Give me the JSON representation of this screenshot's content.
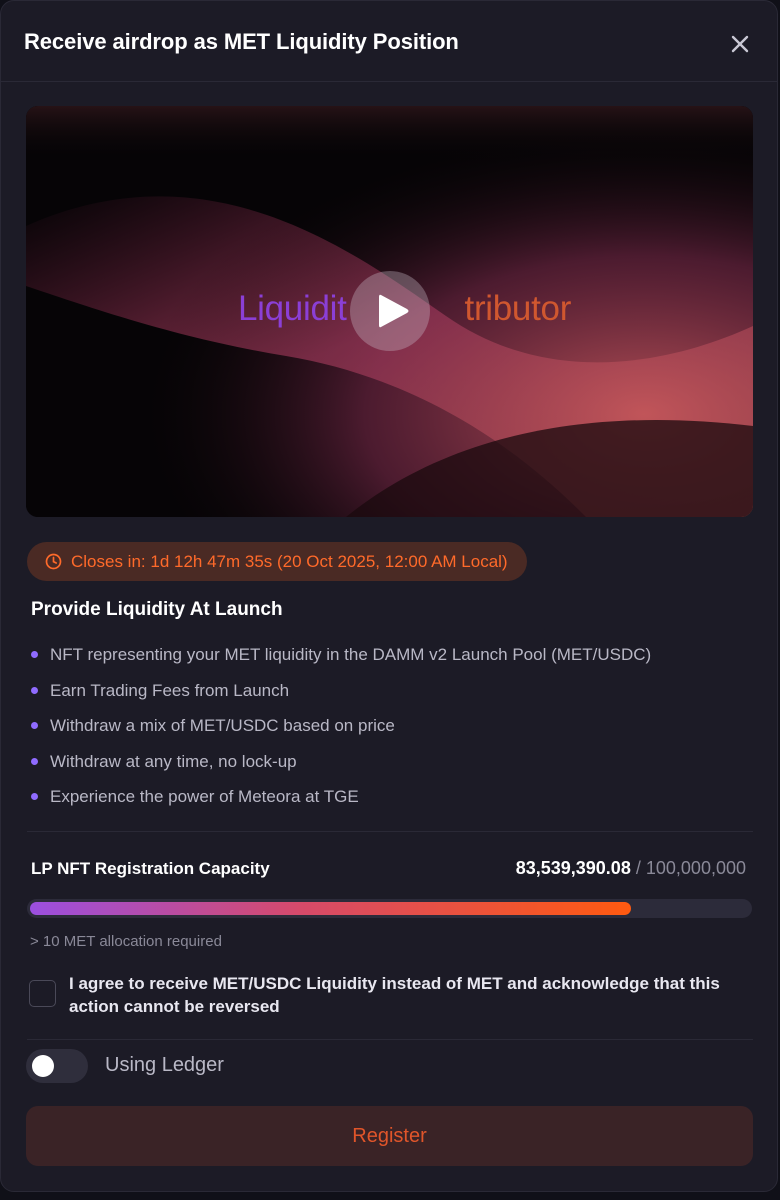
{
  "modal": {
    "title": "Receive airdrop as MET Liquidity Position"
  },
  "video": {
    "caption_part1": "Liquidit",
    "caption_part2": "tributor",
    "caption_color_1": "#8b3fd6",
    "caption_color_2": "#d0572f",
    "play_icon": "play-icon"
  },
  "countdown": {
    "text": "Closes in: 1d 12h 47m 35s (20 Oct 2025, 12:00 AM Local)",
    "icon": "clock-icon",
    "color": "#ff6a2a"
  },
  "section": {
    "title": "Provide Liquidity At Launch",
    "bullets": [
      "NFT representing your MET liquidity in the DAMM v2 Launch Pool (MET/USDC)",
      "Earn Trading Fees from Launch",
      "Withdraw a mix of MET/USDC based on price",
      "Withdraw at any time, no lock-up",
      "Experience the power of Meteora at TGE"
    ]
  },
  "capacity": {
    "label": "LP NFT Registration Capacity",
    "current": "83,539,390.08",
    "separator": "/",
    "total": "100,000,000",
    "fill_fraction": 0.8354,
    "note": "> 10 MET allocation required"
  },
  "agreement": {
    "text": "I agree to receive MET/USDC Liquidity instead of MET and acknowledge that this action cannot be reversed",
    "checked": false
  },
  "ledger": {
    "label": "Using Ledger",
    "enabled": false
  },
  "actions": {
    "register_label": "Register"
  },
  "colors": {
    "accent_orange": "#ff5a10",
    "accent_purple": "#8f6bff",
    "modal_bg": "#1c1b26"
  }
}
